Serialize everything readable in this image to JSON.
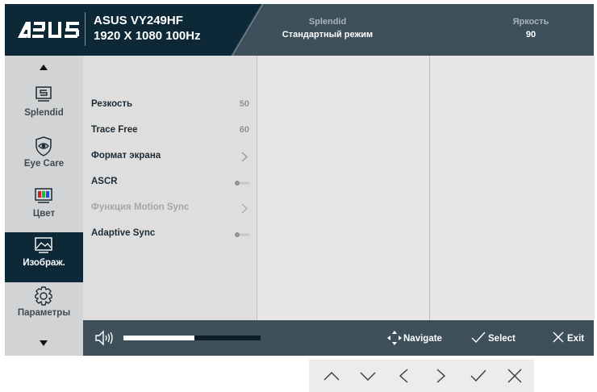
{
  "header": {
    "brand": "ASUS",
    "model": "ASUS VY249HF",
    "resolution": "1920 X 1080 100Hz",
    "splendid_title": "Splendid",
    "splendid_value": "Стандартный режим",
    "brightness_title": "Яркость",
    "brightness_value": "90"
  },
  "sidebar": {
    "items": [
      {
        "label": "Splendid",
        "icon": "monitor-splendid-icon"
      },
      {
        "label": "Eye Care",
        "icon": "eye-shield-icon"
      },
      {
        "label": "Цвет",
        "icon": "color-bars-icon"
      },
      {
        "label": "Изображ.",
        "icon": "image-landscape-icon",
        "active": true
      },
      {
        "label": "Параметры",
        "icon": "gear-icon"
      }
    ]
  },
  "menu": {
    "items": [
      {
        "label": "Резкость",
        "value": "50"
      },
      {
        "label": "Trace Free",
        "value": "60"
      },
      {
        "label": "Формат экрана",
        "control": "submenu"
      },
      {
        "label": "ASCR",
        "control": "toggle-off"
      },
      {
        "label": "Функция Motion Sync",
        "control": "submenu",
        "disabled": true
      },
      {
        "label": "Adaptive Sync",
        "control": "toggle-off"
      }
    ]
  },
  "footer": {
    "volume_level": 0.52,
    "navigate_label": "Navigate",
    "select_label": "Select",
    "exit_label": "Exit"
  },
  "keypad": {
    "keys": [
      "up-chevron-icon",
      "down-chevron-icon",
      "left-chevron-icon",
      "right-chevron-icon",
      "check-icon",
      "close-icon"
    ]
  },
  "colors": {
    "header_dark": "#0d2837",
    "header_mid": "#3c4f5a",
    "sidebar_bg": "#d2d3d4",
    "panel_bg": "#e7e7e7"
  }
}
